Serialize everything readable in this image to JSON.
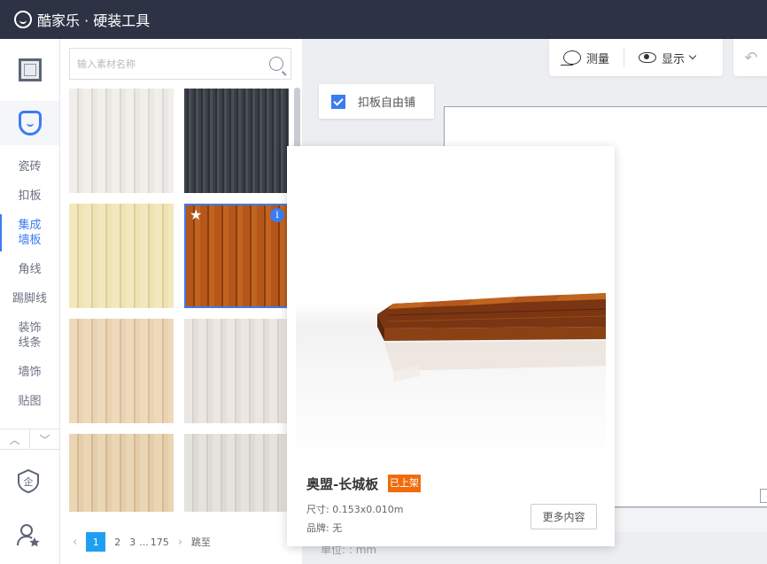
{
  "app": {
    "title": "酷家乐 · 硬装工具"
  },
  "leftnav": {
    "items": [
      {
        "label": "瓷砖"
      },
      {
        "label": "扣板"
      },
      {
        "label": "集成\n墙板",
        "active": true
      },
      {
        "label": "角线"
      },
      {
        "label": "踢脚线"
      },
      {
        "label": "装饰\n线条"
      },
      {
        "label": "墙饰"
      },
      {
        "label": "贴图"
      }
    ]
  },
  "panel": {
    "search_placeholder": "输入素材名称",
    "tiles": [
      {
        "style": "white"
      },
      {
        "style": "dark"
      },
      {
        "style": "yellow"
      },
      {
        "style": "wood",
        "selected": true,
        "favorite": true,
        "info": "i"
      },
      {
        "style": "beige"
      },
      {
        "style": "lightgray"
      },
      {
        "style": "tan"
      },
      {
        "style": "gray"
      }
    ],
    "pager": {
      "current": "1",
      "p2": "2",
      "p3": "3",
      "ellipsis": "...",
      "last": "175",
      "jump": "跳至"
    }
  },
  "toolbar": {
    "measure_label": "测量",
    "display_label": "显示"
  },
  "free_tile": {
    "label": "扣板自由铺",
    "checked": true
  },
  "popup": {
    "title": "奥盟-长城板",
    "status": "已上架",
    "size": "尺寸: 0.153x0.010m",
    "brand": "品牌: 无",
    "more_label": "更多内容"
  },
  "canvas": {
    "unit_text": "单位: : mm"
  },
  "colors": {
    "topbar": "#2e3245",
    "accent": "#3b7cf0",
    "badge": "#f06b0c",
    "page_active": "#1e9ff2"
  }
}
